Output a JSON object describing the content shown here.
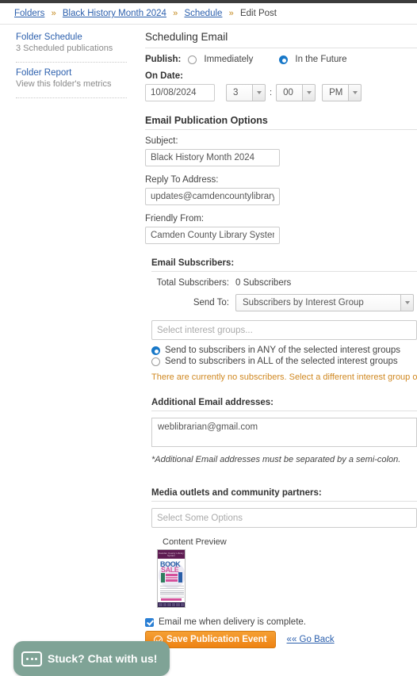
{
  "breadcrumb": {
    "items": [
      {
        "label": "Folders",
        "link": true
      },
      {
        "label": "Black History Month 2024",
        "link": true
      },
      {
        "label": "Schedule",
        "link": true
      },
      {
        "label": "Edit Post",
        "link": false
      }
    ],
    "separator": "»"
  },
  "sidebar": {
    "items": [
      {
        "title": "Folder Schedule",
        "subtitle": "3 Scheduled publications"
      },
      {
        "title": "Folder Report",
        "subtitle": "View this folder's metrics"
      }
    ]
  },
  "main": {
    "scheduling": {
      "heading": "Scheduling Email",
      "publish_label": "Publish:",
      "option_immediately": "Immediately",
      "option_future": "In the Future",
      "selected": "future",
      "on_date_label": "On Date:",
      "date_value": "10/08/2024",
      "hour_value": "3",
      "time_separator": ":",
      "minute_value": "00",
      "meridiem_value": "PM"
    },
    "email_options": {
      "heading": "Email Publication Options",
      "subject_label": "Subject:",
      "subject_value": "Black History Month 2024",
      "reply_to_label": "Reply To Address:",
      "reply_to_value": "updates@camdencountylibrary.org",
      "friendly_from_label": "Friendly From:",
      "friendly_from_value": "Camden County Library System"
    },
    "subscribers": {
      "heading": "Email Subscribers:",
      "total_label": "Total Subscribers:",
      "total_value": "0 Subscribers",
      "send_to_label": "Send To:",
      "send_to_value": "Subscribers by Interest Group",
      "interest_groups_placeholder": "Select interest groups...",
      "radio_any": "Send to subscribers in ANY of the selected interest groups",
      "radio_all": "Send to subscribers in ALL of the selected interest groups",
      "radio_selected": "any",
      "warning": "There are currently no subscribers. Select a different interest group or s",
      "warning_color": "#d08821"
    },
    "additional": {
      "heading": "Additional Email addresses:",
      "value": "weblibrarian@gmail.com",
      "note": "*Additional Email addresses must be separated by a semi-colon."
    },
    "media": {
      "heading": "Media outlets and community partners:",
      "placeholder": "Select Some Options"
    },
    "preview": {
      "label": "Content Preview",
      "thumb_header_text": "Camden County Library System",
      "thumb_title_line1": "BOOK",
      "thumb_title_line2": "SALE"
    },
    "footer": {
      "notify_label": "Email me when delivery is complete.",
      "notify_checked": true,
      "save_label": "Save Publication Event",
      "go_back_label": "«« Go Back",
      "save_color": "#ee8212"
    }
  },
  "chat_widget": {
    "label": "Stuck? Chat with us!",
    "icon": "chat-bubble-icon",
    "color": "#7fa396"
  }
}
